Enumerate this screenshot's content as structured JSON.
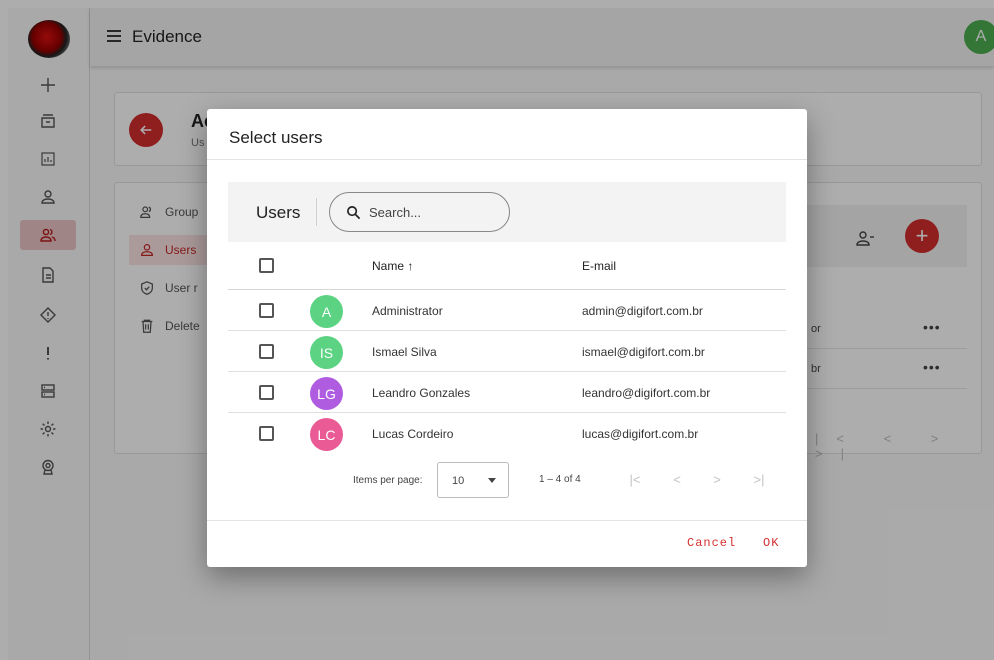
{
  "topbar": {
    "title": "Evidence",
    "user_initial": "A"
  },
  "sidebar": {
    "items": [
      {
        "name": "add-icon"
      },
      {
        "name": "archive-icon"
      },
      {
        "name": "report-icon"
      },
      {
        "name": "user-icon"
      },
      {
        "name": "users-icon",
        "active": true
      },
      {
        "name": "document-icon"
      },
      {
        "name": "alert-diamond-icon"
      },
      {
        "name": "exclamation-icon"
      },
      {
        "name": "storage-icon"
      },
      {
        "name": "settings-icon"
      },
      {
        "name": "badge-icon"
      }
    ]
  },
  "background": {
    "header_title": "Ac",
    "header_subtitle": "Us",
    "nav": [
      {
        "label": "Group"
      },
      {
        "label": "Users",
        "active": true
      },
      {
        "label": "User r"
      },
      {
        "label": "Delete"
      }
    ],
    "rows": [
      {
        "tail": "or",
        "menu": "•••"
      },
      {
        "tail": "br",
        "menu": "•••"
      }
    ],
    "pager": "|< < > >|"
  },
  "dialog": {
    "title": "Select users",
    "toolbar": {
      "label": "Users",
      "search_placeholder": "Search..."
    },
    "columns": {
      "name": "Name ↑",
      "email": "E-mail"
    },
    "rows": [
      {
        "initials": "A",
        "name": "Administrator",
        "email": "admin@digifort.com.br",
        "color": "#5bd382"
      },
      {
        "initials": "IS",
        "name": "Ismael Silva",
        "email": "ismael@digifort.com.br",
        "color": "#5bd382"
      },
      {
        "initials": "LG",
        "name": "Leandro Gonzales",
        "email": "leandro@digifort.com.br",
        "color": "#b05ce0"
      },
      {
        "initials": "LC",
        "name": "Lucas Cordeiro",
        "email": "lucas@digifort.com.br",
        "color": "#ea5a94"
      }
    ],
    "paginator": {
      "items_per_page_label": "Items per page:",
      "items_per_page": "10",
      "range": "1 – 4 of 4",
      "first": "|<",
      "prev": "<",
      "next": ">",
      "last": ">|"
    },
    "actions": {
      "cancel": "Cancel",
      "ok": "OK"
    }
  },
  "colors": {
    "accent": "#d32f2f",
    "overlay": "rgba(0,0,0,0.32)"
  }
}
